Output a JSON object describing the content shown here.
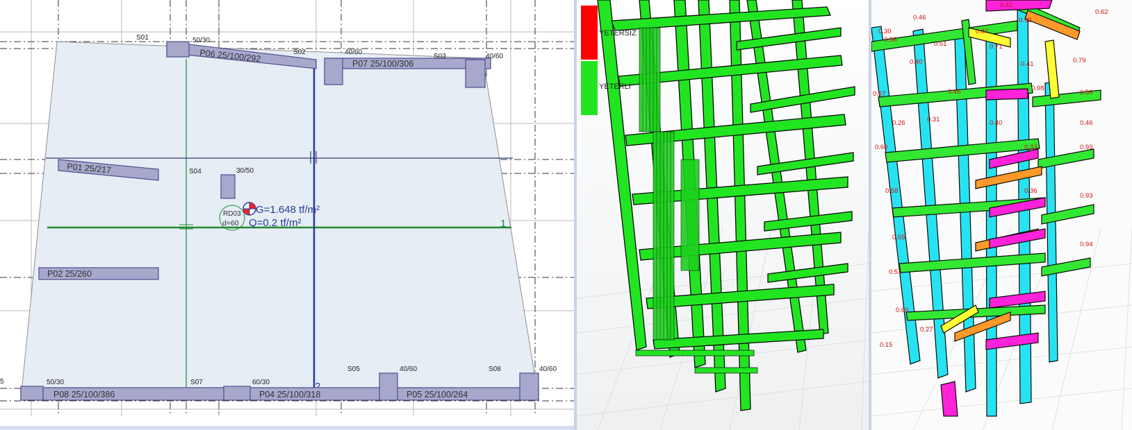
{
  "plan": {
    "column_labels": {
      "S01": "S01",
      "S02": "S02",
      "S03": "S03",
      "S04": "S04",
      "S05": "S05",
      "S07": "S07",
      "S08": "S08",
      "S_edge": "5"
    },
    "dim_labels": {
      "d_50_30_top": "50/30",
      "d_40_60_top_a": "40/60",
      "d_40_60_top_b": "40/60",
      "d_30_50": "30/50",
      "d_50_30_bot": "50/30",
      "d_60_30": "60/30",
      "d_40_60_bot_a": "40/60",
      "d_40_60_bot_b": "40/60"
    },
    "beams": {
      "P06": "P06 25/100/292",
      "P07": "P07 25/100/306",
      "P01": "P01 25/217",
      "P02": "P02 25/260",
      "P08": "P08 25/100/386",
      "P04": "P04 25/100/318",
      "P05": "P05 25/100/264"
    },
    "slab": {
      "id": "RD03",
      "thickness": "d=60"
    },
    "loads": {
      "g": "G=1.648 tf/m²",
      "q": "Q=0.2 tf/m²"
    },
    "axis": {
      "one": "1",
      "two": "2"
    }
  },
  "design_view": {
    "legend": {
      "insufficient": "YETERSİZ",
      "sufficient": "YETERLİ"
    },
    "colors": {
      "insufficient": "#ff0000",
      "sufficient": "#22e522",
      "frame": "#22e522",
      "outline": "#0a0a0a"
    }
  },
  "ratio_view": {
    "colors": {
      "cyan": "#27e3f2",
      "green": "#33e833",
      "yellow": "#ffff33",
      "orange": "#ff9a2a",
      "magenta": "#ff22d8"
    },
    "ratio_labels": [
      "0.30",
      "0.46",
      "0.42",
      "0.62",
      "0.56",
      "0.87",
      "0.92",
      "0.51",
      "0.40",
      "0.71",
      "0.41",
      "0.79",
      "0.67",
      "0.45",
      "0.98",
      "0.59",
      "0.26",
      "0.31",
      "0.40",
      "0.46",
      "0.60",
      "0.33",
      "0.93",
      "0.58",
      "0.36",
      "0.93",
      "0.55",
      "0.94",
      "0.51",
      "0.60",
      "0.27",
      "0.15"
    ]
  }
}
